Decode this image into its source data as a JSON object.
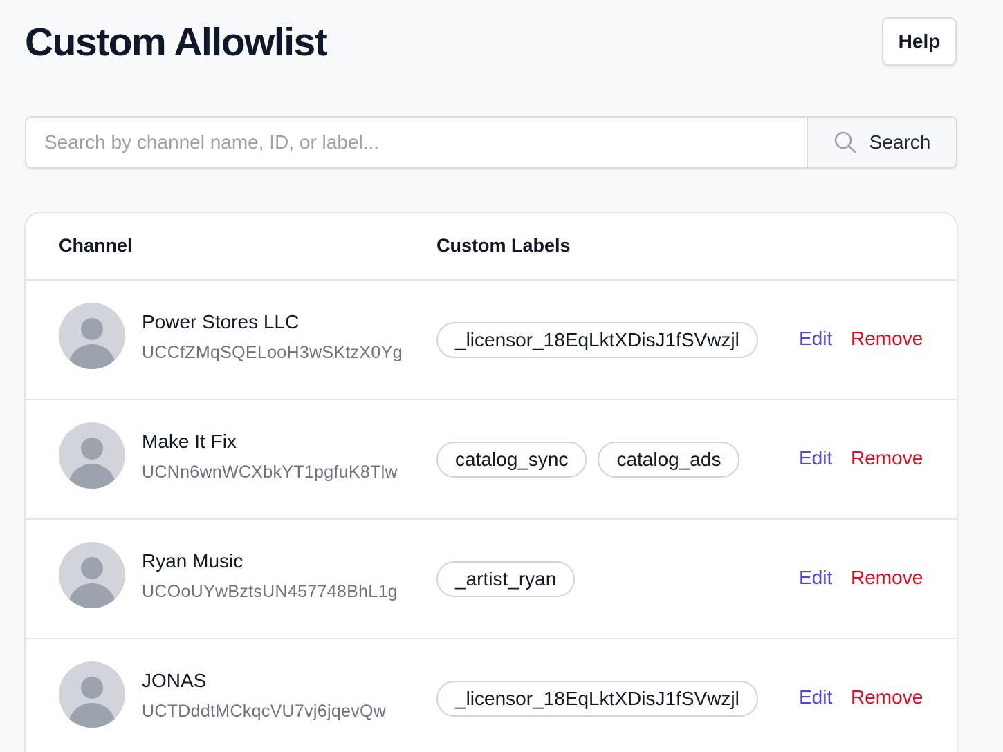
{
  "header": {
    "title": "Custom Allowlist",
    "help_label": "Help"
  },
  "search": {
    "placeholder": "Search by channel name, ID, or label...",
    "value": "",
    "button_label": "Search"
  },
  "table": {
    "columns": {
      "channel": "Channel",
      "labels": "Custom Labels"
    },
    "rows": [
      {
        "name": "Power Stores LLC",
        "id": "UCCfZMqSQELooH3wSKtzX0Yg",
        "labels": [
          "_licensor_18EqLktXDisJ1fSVwzjl"
        ],
        "edit_label": "Edit",
        "remove_label": "Remove"
      },
      {
        "name": "Make It Fix",
        "id": "UCNn6wnWCXbkYT1pgfuK8Tlw",
        "labels": [
          "catalog_sync",
          "catalog_ads"
        ],
        "edit_label": "Edit",
        "remove_label": "Remove"
      },
      {
        "name": "Ryan Music",
        "id": "UCOoUYwBztsUN457748BhL1g",
        "labels": [
          "_artist_ryan"
        ],
        "edit_label": "Edit",
        "remove_label": "Remove"
      },
      {
        "name": "JONAS",
        "id": "UCTDddtMCkqcVU7vj6jqevQw",
        "labels": [
          "_licensor_18EqLktXDisJ1fSVwzjl"
        ],
        "edit_label": "Edit",
        "remove_label": "Remove"
      }
    ]
  },
  "colors": {
    "edit": "#4f46e5",
    "remove": "#dc0a1e",
    "avatar_bg": "#d1d5db",
    "avatar_fg": "#9ca3af"
  },
  "icons": {
    "search": "search-icon",
    "avatar": "user-placeholder-icon"
  }
}
